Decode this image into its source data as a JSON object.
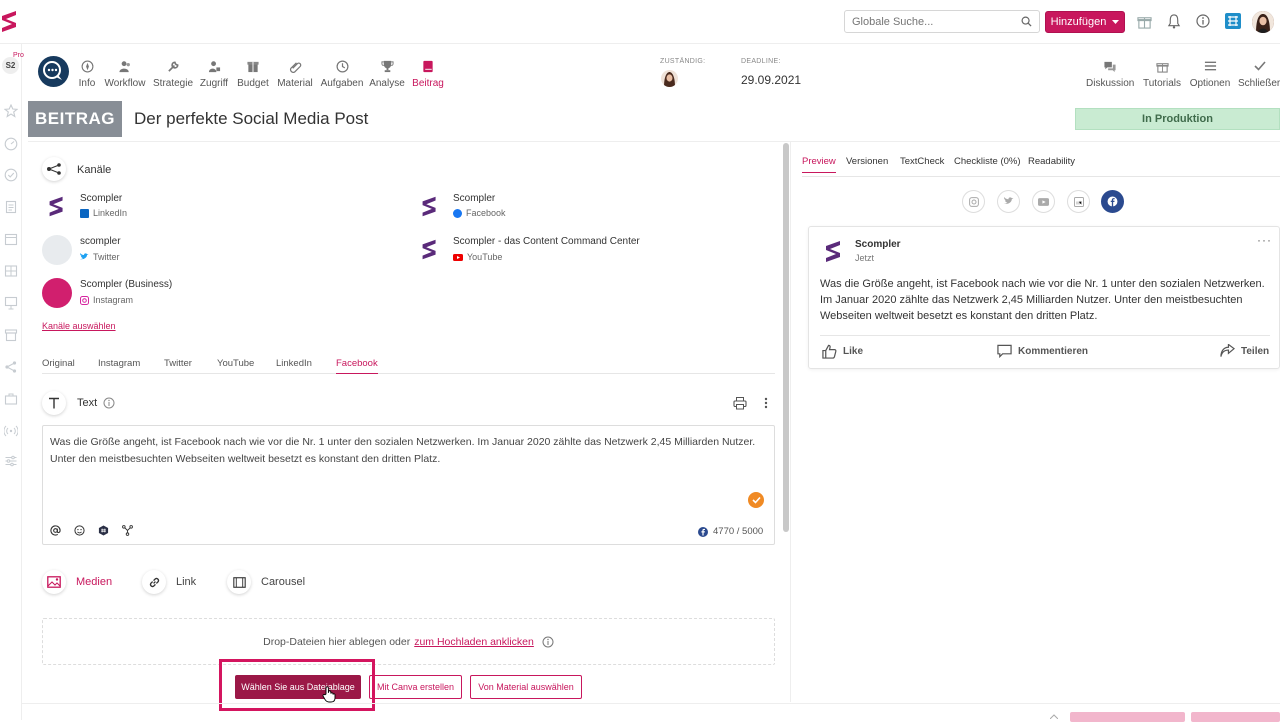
{
  "topbar": {
    "search_placeholder": "Globale Suche...",
    "add_button_label": "Hinzufügen"
  },
  "sidebar": {
    "workspace_badge": "S2",
    "pro_label": "Pro"
  },
  "nav": {
    "items": [
      {
        "label": "Info"
      },
      {
        "label": "Workflow"
      },
      {
        "label": "Strategie"
      },
      {
        "label": "Zugriff"
      },
      {
        "label": "Budget"
      },
      {
        "label": "Material"
      },
      {
        "label": "Aufgaben"
      },
      {
        "label": "Analyse"
      },
      {
        "label": "Beitrag"
      }
    ],
    "responsible_label": "ZUSTÄNDIG:",
    "deadline_label": "DEADLINE:",
    "deadline_value": "29.09.2021",
    "right_items": [
      {
        "label": "Diskussion"
      },
      {
        "label": "Tutorials"
      },
      {
        "label": "Optionen"
      },
      {
        "label": "Schließer"
      }
    ]
  },
  "header": {
    "type_tag": "BEITRAG",
    "title": "Der perfekte Social Media Post",
    "status": "In Produktion"
  },
  "channels": {
    "section_label": "Kanäle",
    "items": [
      {
        "name": "Scompler",
        "network": "LinkedIn"
      },
      {
        "name": "Scompler",
        "network": "Facebook"
      },
      {
        "name": "scompler",
        "network": "Twitter"
      },
      {
        "name": "Scompler - das Content Command Center",
        "network": "YouTube"
      },
      {
        "name": "Scompler (Business)",
        "network": "Instagram"
      }
    ],
    "select_link": "Kanäle auswählen"
  },
  "platform_tabs": [
    "Original",
    "Instagram",
    "Twitter",
    "YouTube",
    "LinkedIn",
    "Facebook"
  ],
  "active_platform_tab": "Facebook",
  "text_section": {
    "label": "Text",
    "content": "Was die Größe angeht, ist Facebook nach wie vor die Nr. 1 unter den sozialen Netzwerken. Im Januar 2020 zählte das Netzwerk 2,45 Milliarden Nutzer. Unter den meistbesuchten Webseiten weltweit besetzt es konstant den dritten Platz.",
    "counter": "4770 / 5000"
  },
  "media": {
    "tabs": [
      "Medien",
      "Link",
      "Carousel"
    ],
    "drop_text": "Drop-Dateien hier ablegen oder",
    "upload_link": "zum Hochladen anklicken",
    "buttons": {
      "choose_file": "Wählen Sie aus Dateiablage",
      "canva": "Mit Canva erstellen",
      "material": "Von Material auswählen"
    }
  },
  "preview": {
    "tabs": [
      "Preview",
      "Versionen",
      "TextCheck",
      "Checkliste (0%)",
      "Readability"
    ],
    "account_name": "Scompler",
    "time": "Jetzt",
    "text": "Was die Größe angeht, ist Facebook nach wie vor die Nr. 1 unter den sozialen Netzwerken. Im Januar 2020 zählte das Netzwerk 2,45 Milliarden Nutzer. Unter den meistbesuchten Webseiten weltweit besetzt es konstant den dritten Platz.",
    "actions": {
      "like": "Like",
      "comment": "Kommentieren",
      "share": "Teilen"
    },
    "dots": "···"
  },
  "colors": {
    "accent": "#c8175d",
    "status_bg": "#c9ebd2",
    "facebook": "#2b4a8f",
    "check": "#f08a24"
  }
}
